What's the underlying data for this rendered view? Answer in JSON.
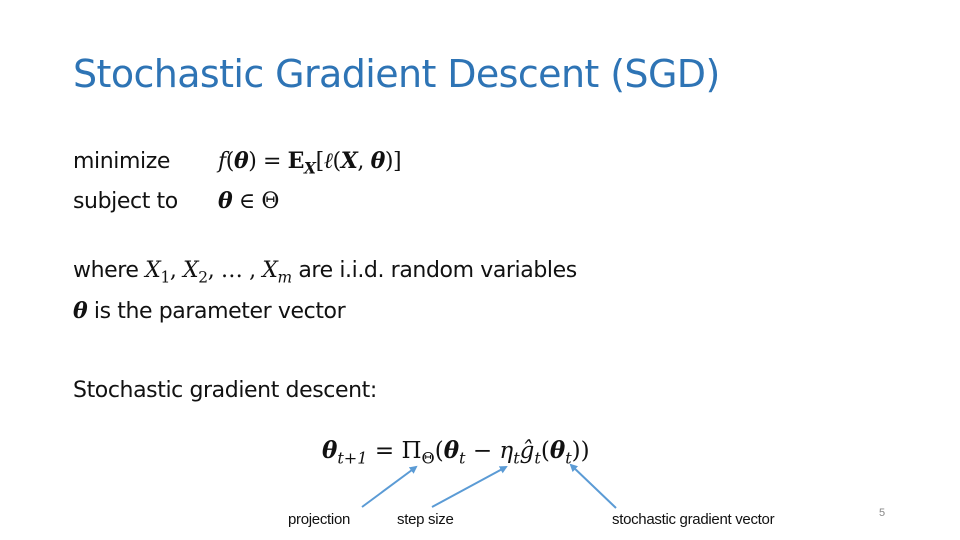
{
  "slide": {
    "title": "Stochastic Gradient Descent (SGD)",
    "problem": {
      "minimize_label": "minimize",
      "objective": {
        "f": "f",
        "open_paren": "(",
        "theta": "θ",
        "close_paren": ")",
        "equals": " = ",
        "expect": "E",
        "expect_sub": "X",
        "bracket_open": "[",
        "loss": "ℓ",
        "open_paren2": "(",
        "X": "X",
        "comma": ", ",
        "theta2": "θ",
        "close": ")]"
      },
      "subject_to_label": "subject to",
      "constraint": {
        "theta": "θ",
        "rest": " ∈ Θ"
      }
    },
    "where_line": {
      "prefix": "where ",
      "X": "X",
      "sub1": "1",
      "sep1": ", ",
      "sub2": "2",
      "sep2": ", … , ",
      "subm": "m",
      "suffix": " are i.i.d. random variables"
    },
    "theta_line": {
      "theta": "θ",
      "suffix": " is the parameter vector"
    },
    "sgd_label": "Stochastic gradient descent:",
    "update_rule": {
      "theta": "θ",
      "sub_t1": "t+1",
      "equals": " = ",
      "Pi": "Π",
      "Pi_sub": "Θ",
      "open": "(",
      "sub_t": "t",
      "minus": " − ",
      "eta": "η",
      "g": "ĝ",
      "open2": "(",
      "close": "))"
    },
    "annotations": {
      "projection": "projection",
      "step_size": "step size",
      "gradient": "stochastic gradient vector"
    },
    "page_number": "5",
    "colors": {
      "title": "#2e74b5",
      "arrow": "#5b9bd5",
      "text": "#111111",
      "page_number": "#888888"
    }
  }
}
